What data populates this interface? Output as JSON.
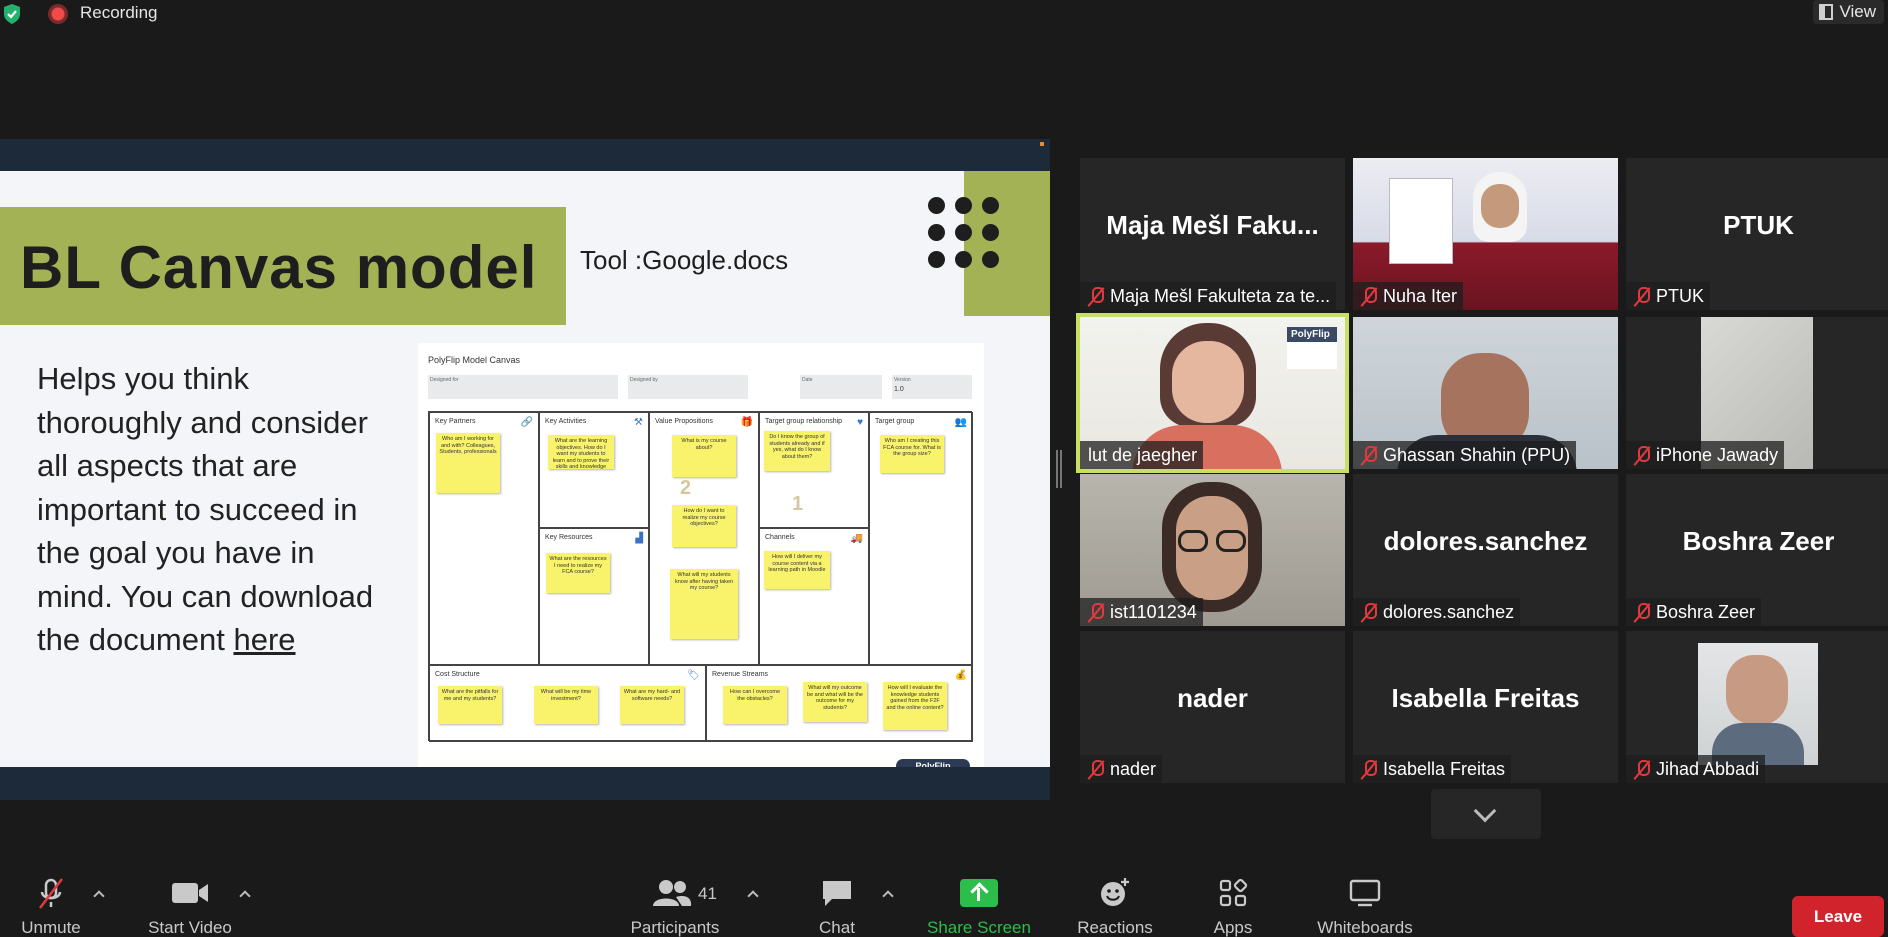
{
  "top_bar": {
    "recording_label": "Recording",
    "view_label": "View"
  },
  "slide": {
    "title": "BL Canvas model",
    "tool": "Tool :Google.docs",
    "body": "Helps you think thoroughly and consider all aspects that are important to succeed in the goal you have in mind. You can download the document ",
    "link": "here",
    "canvas": {
      "name": "PolyFlip Model Canvas",
      "fields": [
        "Designed for",
        "Designed by",
        "Date",
        "Version"
      ],
      "version": "1.0",
      "sections": [
        "Key Partners",
        "Key Activities",
        "Value Propositions",
        "Target group relationship",
        "Target group",
        "Key Resources",
        "Channels",
        "Cost Structure",
        "Revenue Streams"
      ],
      "stickies": {
        "kp": "Who am I working for and with? Colleagues, Students, professionals",
        "ka": "What are the learning objectives. How do I want my students to learn and to prove their skills and knowledge",
        "vp1": "What is my course about?",
        "vp2": "How do I want to realize my course objectives?",
        "vp3": "What will my students know after having taken my course?",
        "tgr": "Do I know the group of students already and if yes, what do I know about them?",
        "tg": "Who am I creating this FCA course for. What is the group size?",
        "kr": "What are the resources I need to realize my FCA course?",
        "ch": "How will I deliver my course content via a learning path in Moodle",
        "cs1": "What are the pitfalls for me and my students?",
        "cs2": "What will be my time investment?",
        "cs3": "What are my hard- and software needs?",
        "rs1": "How can I overcome the obstacles?",
        "rs2": "What will my outcome be and what will be the outcome for my students?",
        "rs3": "How will I evaluate the knowledge students gained from the F2F and the online content?"
      },
      "num_2": "2",
      "num_1": "1",
      "brand": "PolyFlip"
    }
  },
  "participants": [
    {
      "tile_name": "Maja Mešl Faku...",
      "label": "Maja Mešl Fakulteta za te...",
      "muted": true,
      "video": false
    },
    {
      "tile_name": "",
      "label": "Nuha Iter",
      "muted": true,
      "video": true
    },
    {
      "tile_name": "PTUK",
      "label": "PTUK",
      "muted": true,
      "video": false
    },
    {
      "tile_name": "",
      "label": "lut de jaegher",
      "muted": false,
      "video": true,
      "active": true
    },
    {
      "tile_name": "",
      "label": "Ghassan Shahin (PPU)",
      "muted": true,
      "video": true
    },
    {
      "tile_name": "",
      "label": "iPhone Jawady",
      "muted": true,
      "video": true
    },
    {
      "tile_name": "",
      "label": "ist1101234",
      "muted": true,
      "video": true
    },
    {
      "tile_name": "dolores.sanchez",
      "label": "dolores.sanchez",
      "muted": true,
      "video": false
    },
    {
      "tile_name": "Boshra Zeer",
      "label": "Boshra Zeer",
      "muted": true,
      "video": false
    },
    {
      "tile_name": "nader",
      "label": "nader",
      "muted": true,
      "video": false
    },
    {
      "tile_name": "Isabella Freitas",
      "label": "Isabella Freitas",
      "muted": true,
      "video": false
    },
    {
      "tile_name": "",
      "label": "Jihad Abbadi",
      "muted": true,
      "video": true
    }
  ],
  "polyflip_logo": "PolyFlip",
  "toolbar": {
    "unmute": "Unmute",
    "start_video": "Start Video",
    "participants": "Participants",
    "participants_count": "41",
    "chat": "Chat",
    "share_screen": "Share Screen",
    "reactions": "Reactions",
    "apps": "Apps",
    "whiteboards": "Whiteboards",
    "leave": "Leave"
  },
  "colors": {
    "accent_green": "#a2b255",
    "active_speaker": "#c7df62",
    "leave_red": "#d1232c",
    "share_green": "#2cbd4a",
    "muted_red": "#e0393e"
  }
}
